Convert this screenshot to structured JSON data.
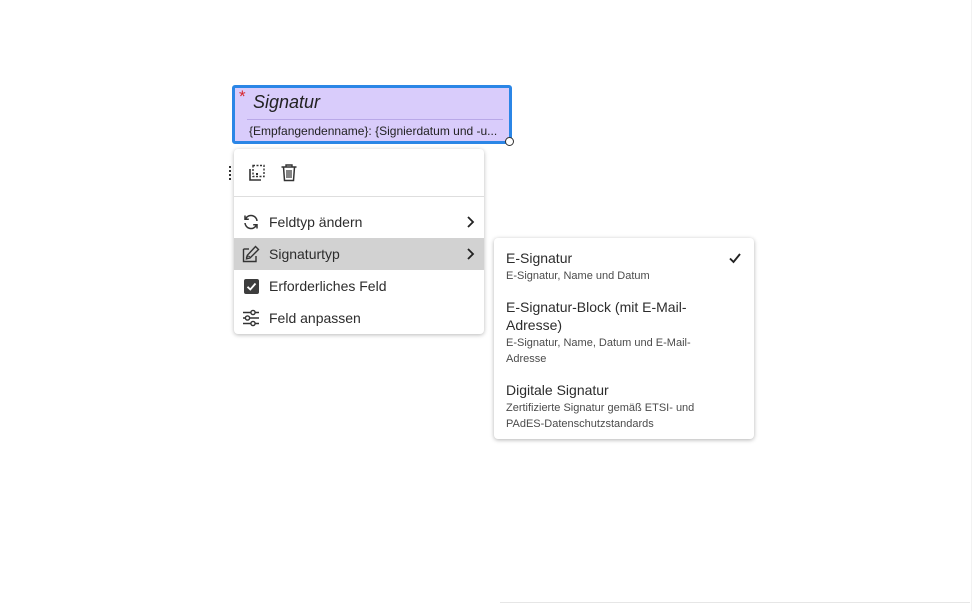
{
  "signature_field": {
    "required_marker": "*",
    "title": "Signatur",
    "subtitle": "{Empfangendenname}: {Signierdatum und -u..."
  },
  "toolbar": {
    "duplicate_icon": "duplicate-icon",
    "delete_icon": "trash-icon"
  },
  "context_menu": {
    "items": [
      {
        "label": "Feldtyp ändern",
        "icon": "refresh-icon",
        "has_submenu": true
      },
      {
        "label": "Signaturtyp",
        "icon": "sign-pen-icon",
        "has_submenu": true,
        "selected": true
      },
      {
        "label": "Erforderliches Feld",
        "icon": "checkbox-icon",
        "checked": true
      },
      {
        "label": "Feld anpassen",
        "icon": "sliders-icon"
      }
    ]
  },
  "submenu": {
    "items": [
      {
        "title": "E-Signatur",
        "description": "E-Signatur, Name und Datum",
        "checked": true
      },
      {
        "title": "E-Signatur-Block (mit E-Mail-Adresse)",
        "description": "E-Signatur, Name, Datum und E-Mail-Adresse"
      },
      {
        "title": "Digitale Signatur",
        "description": "Zertifizierte Signatur gemäß ETSI- und PAdES-Datenschutzstandards"
      }
    ]
  },
  "colors": {
    "field_fill": "#d9ccfb",
    "field_border": "#2b86e6",
    "required_red": "#d7262b",
    "selected_row": "#d2d2d2"
  }
}
